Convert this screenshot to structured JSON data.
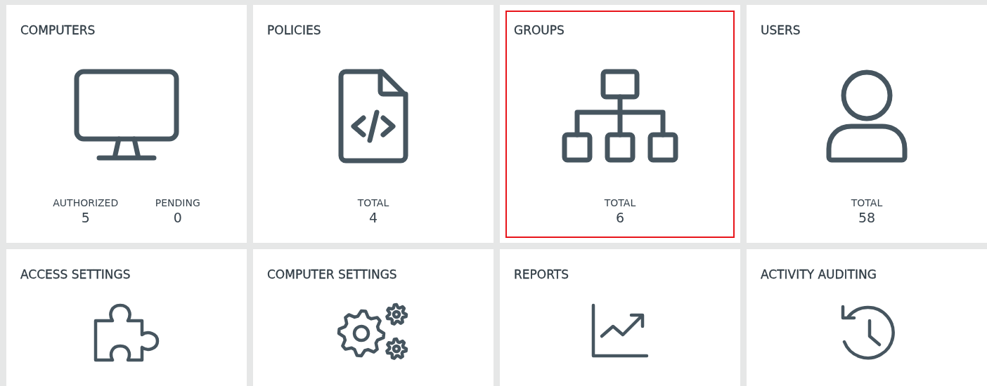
{
  "tiles": [
    {
      "title": "COMPUTERS",
      "highlighted": false,
      "stats": [
        {
          "label": "AUTHORIZED",
          "value": "5"
        },
        {
          "label": "PENDING",
          "value": "0"
        }
      ]
    },
    {
      "title": "POLICIES",
      "highlighted": false,
      "stats": [
        {
          "label": "TOTAL",
          "value": "4"
        }
      ]
    },
    {
      "title": "GROUPS",
      "highlighted": true,
      "stats": [
        {
          "label": "TOTAL",
          "value": "6"
        }
      ]
    },
    {
      "title": "USERS",
      "highlighted": false,
      "stats": [
        {
          "label": "TOTAL",
          "value": "58"
        }
      ]
    },
    {
      "title": "ACCESS SETTINGS",
      "highlighted": false
    },
    {
      "title": "COMPUTER SETTINGS",
      "highlighted": false
    },
    {
      "title": "REPORTS",
      "highlighted": false
    },
    {
      "title": "ACTIVITY AUDITING",
      "highlighted": false
    }
  ]
}
